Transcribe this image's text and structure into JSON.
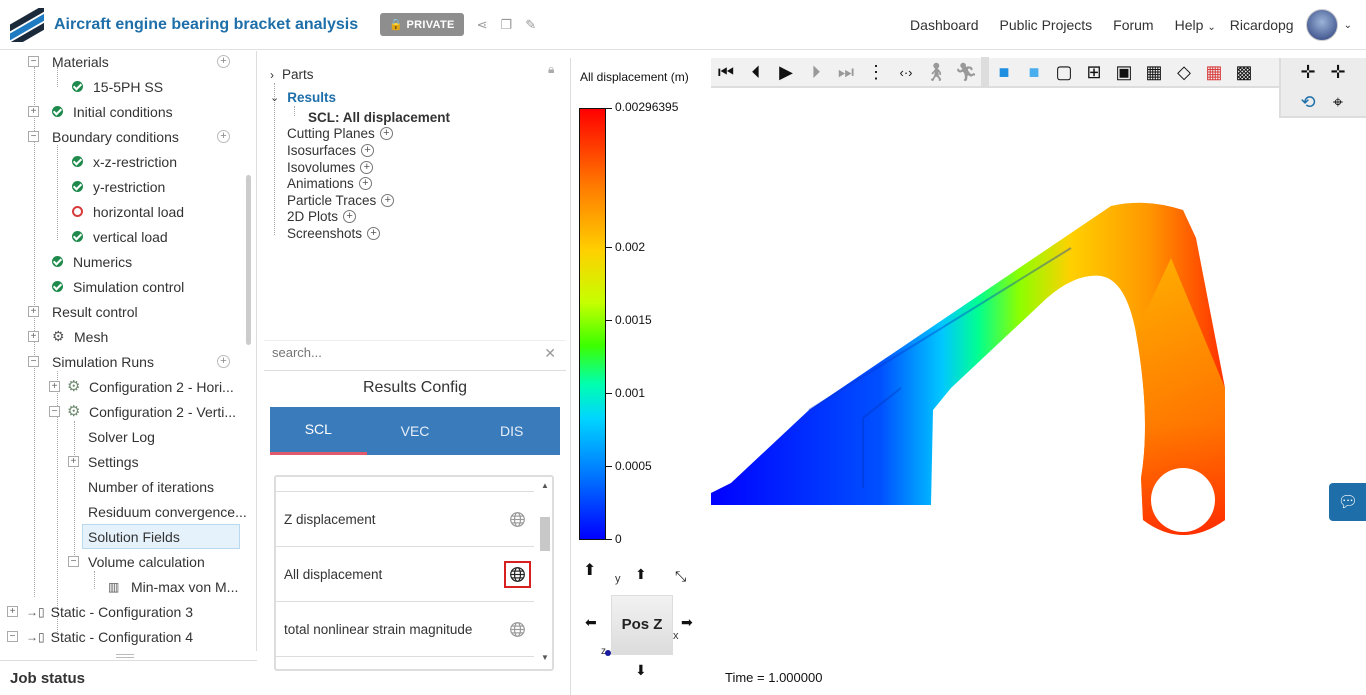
{
  "header": {
    "title": "Aircraft engine bearing bracket analysis",
    "private_label": "PRIVATE",
    "nav": {
      "dashboard": "Dashboard",
      "public_projects": "Public Projects",
      "forum": "Forum",
      "help": "Help",
      "user": "Ricardopg"
    }
  },
  "tree": {
    "items": [
      {
        "label": "Materials"
      },
      {
        "label": "15-5PH SS"
      },
      {
        "label": "Initial conditions"
      },
      {
        "label": "Boundary conditions"
      },
      {
        "label": "x-z-restriction"
      },
      {
        "label": "y-restriction"
      },
      {
        "label": "horizontal load"
      },
      {
        "label": "vertical load"
      },
      {
        "label": "Numerics"
      },
      {
        "label": "Simulation control"
      },
      {
        "label": "Result control"
      },
      {
        "label": "Mesh"
      },
      {
        "label": "Simulation Runs"
      },
      {
        "label": "Configuration 2 - Hori..."
      },
      {
        "label": "Configuration 2 - Verti..."
      },
      {
        "label": "Solver Log"
      },
      {
        "label": "Settings"
      },
      {
        "label": "Number of iterations"
      },
      {
        "label": "Residuum convergence..."
      },
      {
        "label": "Solution Fields"
      },
      {
        "label": "Volume calculation"
      },
      {
        "label": "Min-max von M..."
      },
      {
        "label": "Static - Configuration 3"
      },
      {
        "label": "Static - Configuration 4"
      }
    ]
  },
  "job_status": "Job status",
  "scene": {
    "parts": "Parts",
    "results": "Results",
    "scl_item": "SCL: All displacement",
    "cutting_planes": "Cutting Planes",
    "isosurfaces": "Isosurfaces",
    "isovolumes": "Isovolumes",
    "animations": "Animations",
    "particle_traces": "Particle Traces",
    "plots_2d": "2D Plots",
    "screenshots": "Screenshots",
    "search_placeholder": "search..."
  },
  "results_config": {
    "title": "Results Config",
    "tabs": [
      "SCL",
      "VEC",
      "DIS"
    ],
    "items": [
      "Z displacement",
      "All displacement",
      "total nonlinear strain magnitude"
    ]
  },
  "viewer": {
    "legend_title": "All displacement (m)",
    "legend_ticks": [
      "0.00296395",
      "0.002",
      "0.0015",
      "0.001",
      "0.0005",
      "0"
    ],
    "cube_label": "Pos Z",
    "axis_y": "y",
    "axis_x": "x",
    "axis_z": "z",
    "time_label": "Time = 1.000000"
  },
  "colors": {
    "accent": "#1e6fa9",
    "tab_bar": "#3a7bbb",
    "tab_underline": "#e05a6b",
    "ok_green": "#1f8a4c",
    "error_red": "#d83b3b"
  }
}
